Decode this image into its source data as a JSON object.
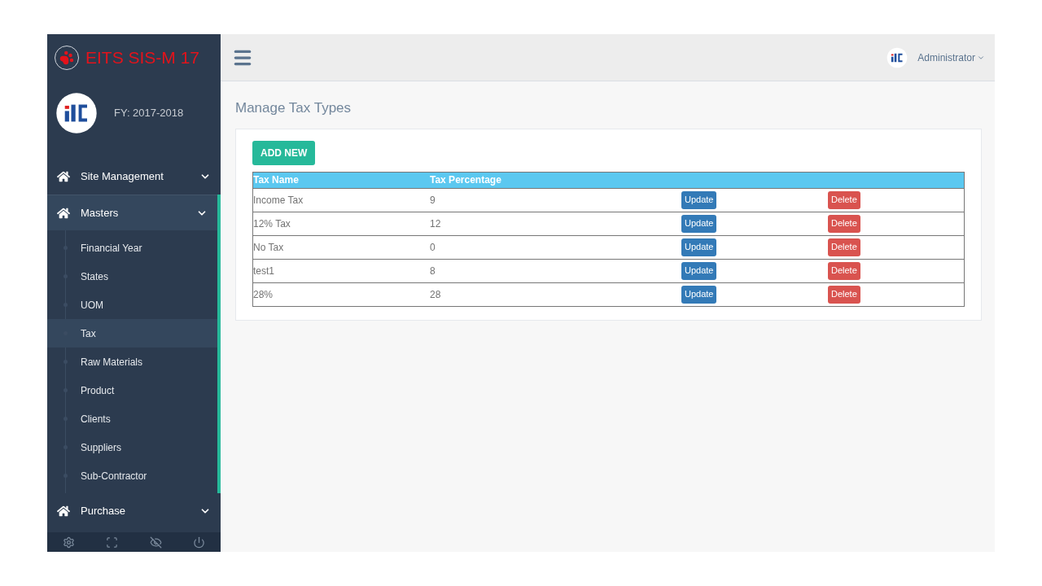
{
  "brand": {
    "title": "EITS SIS-M 17"
  },
  "fiscal_year": "FY: 2017-2018",
  "nav": [
    {
      "label": "Site Management",
      "expanded": false
    },
    {
      "label": "Masters",
      "expanded": true,
      "children": [
        {
          "label": "Financial Year",
          "selected": false
        },
        {
          "label": "States",
          "selected": false
        },
        {
          "label": "UOM",
          "selected": false
        },
        {
          "label": "Tax",
          "selected": true
        },
        {
          "label": "Raw Materials",
          "selected": false
        },
        {
          "label": "Product",
          "selected": false
        },
        {
          "label": "Clients",
          "selected": false
        },
        {
          "label": "Suppliers",
          "selected": false
        },
        {
          "label": "Sub-Contractor",
          "selected": false
        }
      ]
    },
    {
      "label": "Purchase",
      "expanded": false
    }
  ],
  "user": {
    "name": "Administrator"
  },
  "page_title": "Manage Tax Types",
  "add_button": "ADD NEW",
  "table": {
    "columns": [
      "Tax Name",
      "Tax Percentage"
    ],
    "rows": [
      {
        "name": "Income Tax",
        "percentage": "9",
        "update": "Update",
        "delete": "Delete"
      },
      {
        "name": "12% Tax",
        "percentage": "12",
        "update": "Update",
        "delete": "Delete"
      },
      {
        "name": "No Tax",
        "percentage": "0",
        "update": "Update",
        "delete": "Delete"
      },
      {
        "name": "test1",
        "percentage": "8",
        "update": "Update",
        "delete": "Delete"
      },
      {
        "name": "28%",
        "percentage": "28",
        "update": "Update",
        "delete": "Delete"
      }
    ]
  }
}
